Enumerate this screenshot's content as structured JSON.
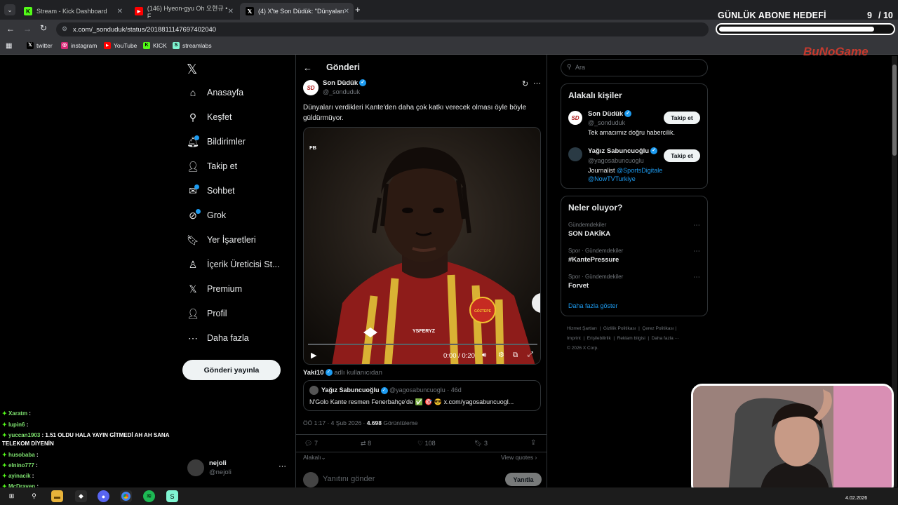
{
  "tabs": [
    {
      "label": "Stream - Kick Dashboard",
      "icon": "kick-icon"
    },
    {
      "label": "(146) Hyeon-gyu Oh 오현규 • F",
      "icon": "youtube-icon"
    },
    {
      "label": "(4) X'te Son Düdük: \"Dünyaları",
      "icon": "x-icon"
    }
  ],
  "new_tab": "+",
  "url": "x.com/_sonduduk/status/2018811147697402040",
  "bookmarks": [
    {
      "label": "twitter",
      "icon": "x-icon"
    },
    {
      "label": "instagram",
      "icon": "instagram-icon"
    },
    {
      "label": "YouTube",
      "icon": "youtube-icon"
    },
    {
      "label": "KICK",
      "icon": "kick-icon"
    },
    {
      "label": "streamlabs",
      "icon": "streamlabs-icon"
    }
  ],
  "overlay": {
    "goal_title": "GÜNLÜK ABONE HEDEFİ",
    "goal_count": "9",
    "goal_total": "/ 10",
    "goal_progress": 0.9,
    "brand": "BuNoGame"
  },
  "nav": {
    "items": [
      {
        "label": "Anasayfa",
        "icon": "home-icon",
        "glyph": "⌂"
      },
      {
        "label": "Keşfet",
        "icon": "search-icon",
        "glyph": "⚲"
      },
      {
        "label": "Bildirimler",
        "icon": "bell-icon",
        "glyph": "🔔︎"
      },
      {
        "label": "Takip et",
        "icon": "add-person-icon",
        "glyph": "👤︎"
      },
      {
        "label": "Sohbet",
        "icon": "mail-icon",
        "glyph": "✉"
      },
      {
        "label": "Grok",
        "icon": "grok-icon",
        "glyph": "⊘"
      },
      {
        "label": "Yer İşaretleri",
        "icon": "bookmark-icon",
        "glyph": "🔖︎"
      },
      {
        "label": "İçerik Üreticisi St...",
        "icon": "creator-icon",
        "glyph": "♙"
      },
      {
        "label": "Premium",
        "icon": "x-premium-icon",
        "glyph": "𝕏"
      },
      {
        "label": "Profil",
        "icon": "profile-icon",
        "glyph": "👤︎"
      },
      {
        "label": "Daha fazla",
        "icon": "more-circle-icon",
        "glyph": "⋯"
      }
    ],
    "post_button": "Gönderi yayınla",
    "account": {
      "name": "nejoli",
      "handle": "@nejoli"
    }
  },
  "post": {
    "header": "Gönderi",
    "author": "Son Düdük",
    "handle": "@_sonduduk",
    "avatar_text": "SD",
    "text": "Dünyaları verdikleri Kante'den daha çok katkı verecek olması öyle böyle güldürmüyor.",
    "video": {
      "badge": "FB",
      "time": "0:00 / 0:20",
      "watermark": "YSFERYZ",
      "crest_text": "GÖZTEPE"
    },
    "credit_name": "Yaki10",
    "credit_suffix": "adlı kullanıcıdan",
    "quote": {
      "author": "Yağız Sabuncuoğlu",
      "handle": "@yagosabuncuoglu",
      "age": "· 46d",
      "text": "N'Golo Kante resmen Fenerbahçe'de ✅ 🎯 😎 x.com/yagosabuncuogl..."
    },
    "meta_time": "ÖÖ 1:17 · 4 Şub 2026 ·",
    "views": "4.698",
    "views_label": "Görüntüleme",
    "stats": {
      "replies": "7",
      "reposts": "8",
      "likes": "108",
      "bookmarks": "3"
    },
    "relevant": "Alakalı",
    "view_quotes": "View quotes",
    "reply_placeholder": "Yanıtını gönder",
    "reply_button": "Yanıtla"
  },
  "search": {
    "placeholder": "Ara"
  },
  "relevant_people": {
    "title": "Alakalı kişiler",
    "people": [
      {
        "name": "Son Düdük",
        "handle": "@_sonduduk",
        "bio": "Tek amacımız doğru habercilik.",
        "follow": "Takip et"
      },
      {
        "name": "Yağız Sabuncuoğlu",
        "handle": "@yagosabuncuoglu",
        "bio": "Journalist",
        "bio_links": [
          "@SportsDigitale",
          "@NowTVTurkiye"
        ],
        "follow": "Takip et"
      }
    ]
  },
  "trends": {
    "title": "Neler oluyor?",
    "items": [
      {
        "context": "Gündemdekiler",
        "name": "SON DAKİKA"
      },
      {
        "context": "Spor · Gündemdekiler",
        "name": "#KantePressure"
      },
      {
        "context": "Spor · Gündemdekiler",
        "name": "Forvet"
      }
    ],
    "show_more": "Daha fazla göster"
  },
  "footer_links": [
    "Hizmet Şartları",
    "Gizlilik Politikası",
    "Çerez Politikası",
    "Imprint",
    "Erişilebilirlik",
    "Reklam bilgisi",
    "Daha fazla ···",
    "© 2026 X Corp."
  ],
  "chat": [
    {
      "user": "Xaratm",
      "msg": ""
    },
    {
      "user": "lupin6",
      "msg": ""
    },
    {
      "user": "yuccan1903",
      "msg": "1.51 OLDU HALA YAYIN GİTMEDİ AH AH SANA TELEKOM DİYENİN"
    },
    {
      "user": "husobaba",
      "msg": ""
    },
    {
      "user": "elnino777",
      "msg": ""
    },
    {
      "user": "ayinacik",
      "msg": ""
    },
    {
      "user": "McDraven",
      "msg": ""
    }
  ],
  "taskbar": {
    "date": "4.02.2026"
  },
  "colors": {
    "accent": "#1d9bf0",
    "bg": "#000000",
    "border": "#2f3336",
    "muted": "#71767b"
  }
}
